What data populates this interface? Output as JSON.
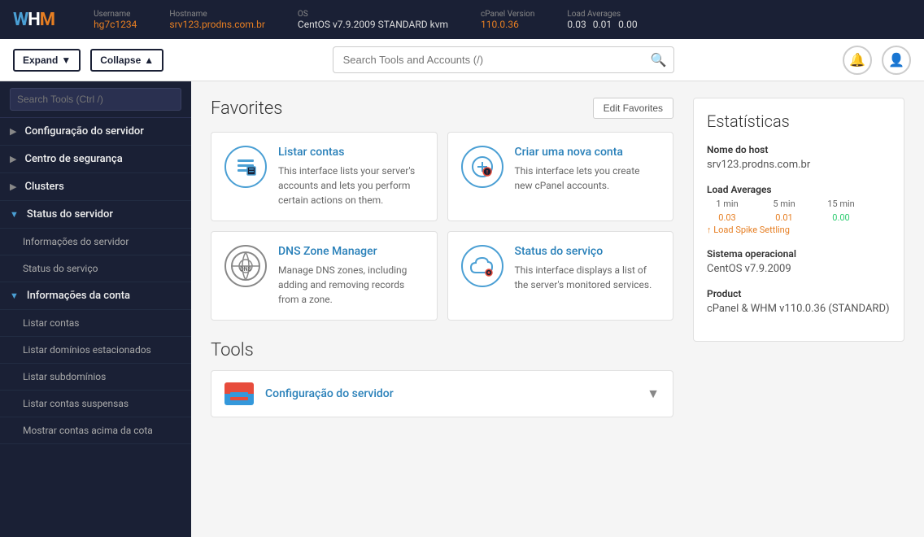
{
  "topbar": {
    "logo": "WHM",
    "username_label": "Username",
    "username": "hg7c1234",
    "hostname_label": "Hostname",
    "hostname": "srv123.prodns.com.br",
    "os_label": "OS",
    "os": "CentOS v7.9.2009 STANDARD kvm",
    "cpanel_label": "cPanel Version",
    "cpanel": "110.0.36",
    "load_label": "Load Averages",
    "load_1": "0.03",
    "load_5": "0.01",
    "load_15": "0.00"
  },
  "toolbar": {
    "expand_label": "Expand",
    "collapse_label": "Collapse",
    "search_placeholder": "Search Tools and Accounts (/)"
  },
  "sidebar": {
    "search_placeholder": "Search Tools (Ctrl /)",
    "items": [
      {
        "label": "Configuração do servidor",
        "expanded": false,
        "level": 0
      },
      {
        "label": "Centro de segurança",
        "expanded": false,
        "level": 0
      },
      {
        "label": "Clusters",
        "expanded": false,
        "level": 0
      },
      {
        "label": "Status do servidor",
        "expanded": true,
        "level": 0
      },
      {
        "label": "Informações do servidor",
        "level": 1
      },
      {
        "label": "Status do serviço",
        "level": 1
      },
      {
        "label": "Informações da conta",
        "expanded": true,
        "level": 0
      },
      {
        "label": "Listar contas",
        "level": 1
      },
      {
        "label": "Listar domínios estacionados",
        "level": 1
      },
      {
        "label": "Listar subdomínios",
        "level": 1
      },
      {
        "label": "Listar contas suspensas",
        "level": 1
      },
      {
        "label": "Mostrar contas acima da cota",
        "level": 1
      }
    ]
  },
  "favorites": {
    "title": "Favorites",
    "edit_button": "Edit Favorites",
    "cards": [
      {
        "title": "Listar contas",
        "description": "This interface lists your server's accounts and lets you perform certain actions on them.",
        "icon_type": "list"
      },
      {
        "title": "Criar uma nova conta",
        "description": "This interface lets you create new cPanel accounts.",
        "icon_type": "add"
      },
      {
        "title": "DNS Zone Manager",
        "description": "Manage DNS zones, including adding and removing records from a zone.",
        "icon_type": "dns"
      },
      {
        "title": "Status do serviço",
        "description": "This interface displays a list of the server's monitored services.",
        "icon_type": "cloud"
      }
    ]
  },
  "tools": {
    "title": "Tools",
    "items": [
      {
        "label": "Configuração do servidor"
      }
    ]
  },
  "stats": {
    "title": "Estatísticas",
    "hostname_label": "Nome do host",
    "hostname": "srv123.prodns.com.br",
    "load_label": "Load Averages",
    "load_1min_label": "1 min",
    "load_5min_label": "5 min",
    "load_15min_label": "15 min",
    "load_1min": "0.03",
    "load_5min": "0.01",
    "load_15min": "0.00",
    "load_spike": "↑ Load Spike Settling",
    "os_label": "Sistema operacional",
    "os": "CentOS v7.9.2009",
    "product_label": "Product",
    "product": "cPanel & WHM v110.0.36 (STANDARD)"
  }
}
